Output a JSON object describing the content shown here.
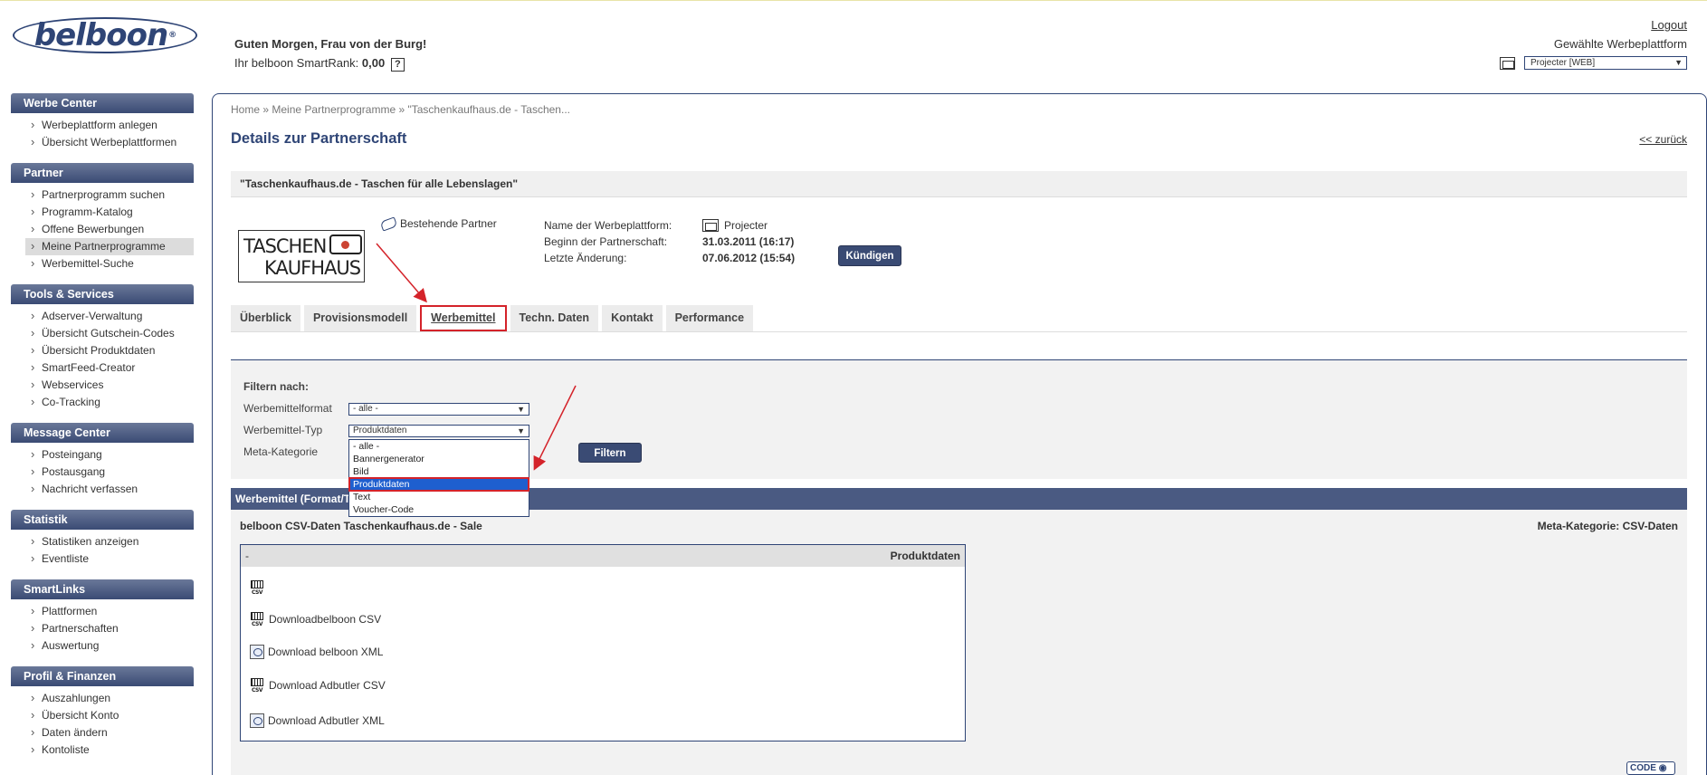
{
  "header": {
    "logo_text": "belboon",
    "logo_reg": "®",
    "greeting": "Guten Morgen, Frau von der Burg!",
    "smartrank_label": "Ihr belboon SmartRank:",
    "smartrank_value": "0,00",
    "help": "?",
    "logout": "Logout",
    "platform_label": "Gewählte Werbeplattform",
    "platform_value": "Projecter [WEB]"
  },
  "sidebar": [
    {
      "title": "Werbe Center",
      "items": [
        "Werbeplattform anlegen",
        "Übersicht Werbeplattformen"
      ]
    },
    {
      "title": "Partner",
      "items": [
        "Partnerprogramm suchen",
        "Programm-Katalog",
        "Offene Bewerbungen",
        "Meine Partnerprogramme",
        "Werbemittel-Suche"
      ]
    },
    {
      "title": "Tools & Services",
      "items": [
        "Adserver-Verwaltung",
        "Übersicht Gutschein-Codes",
        "Übersicht Produktdaten",
        "SmartFeed-Creator",
        "Webservices",
        "Co-Tracking"
      ]
    },
    {
      "title": "Message Center",
      "items": [
        "Posteingang",
        "Postausgang",
        "Nachricht verfassen"
      ]
    },
    {
      "title": "Statistik",
      "items": [
        "Statistiken anzeigen",
        "Eventliste"
      ]
    },
    {
      "title": "SmartLinks",
      "items": [
        "Plattformen",
        "Partnerschaften",
        "Auswertung"
      ]
    },
    {
      "title": "Profil & Finanzen",
      "items": [
        "Auszahlungen",
        "Übersicht Konto",
        "Daten ändern",
        "Kontoliste"
      ]
    }
  ],
  "breadcrumb": {
    "home": "Home",
    "sep": "»",
    "mine": "Meine Partnerprogramme",
    "current": "\"Taschenkaufhaus.de - Taschen..."
  },
  "page_title": "Details zur Partnerschaft",
  "back": "<< zurück",
  "program_name": "\"Taschenkaufhaus.de - Taschen für alle Lebenslagen\"",
  "merchant_logo": {
    "line1": "TASCHEN",
    "line2": "KAUFHAUS"
  },
  "partner_status": "Bestehende Partner",
  "info": {
    "platform_label": "Name der Werbeplattform:",
    "platform_value": "Projecter",
    "begin_label": "Beginn der Partnerschaft:",
    "begin_value": "31.03.2011 (16:17)",
    "change_label": "Letzte Änderung:",
    "change_value": "07.06.2012 (15:54)"
  },
  "cancel_button": "Kündigen",
  "tabs": [
    "Überblick",
    "Provisionsmodell",
    "Werbemittel",
    "Techn. Daten",
    "Kontakt",
    "Performance"
  ],
  "filter": {
    "title": "Filtern nach:",
    "format_label": "Werbemittelformat",
    "format_value": "- alle -",
    "type_label": "Werbemittel-Typ",
    "type_value": "Produktdaten",
    "meta_label": "Meta-Kategorie",
    "button": "Filtern",
    "options": [
      "- alle -",
      "Bannergenerator",
      "Bild",
      "Produktdaten",
      "Text",
      "Voucher-Code"
    ]
  },
  "results": {
    "bar": "Werbemittel (Format/T",
    "title": "belboon CSV-Daten Taschenkaufhaus.de - Sale",
    "meta": "Meta-Kategorie: CSV-Daten",
    "table_left": "-",
    "table_right": "Produktdaten",
    "downloads": [
      "Downloadbelboon CSV",
      "Download belboon XML",
      "Download Adbutler CSV",
      "Download Adbutler XML"
    ],
    "csv": "CSV"
  },
  "code_button": "CODE",
  "colors": {
    "accent": "#2f4576",
    "highlight": "#d4232a",
    "selected": "#1e5fcf"
  }
}
